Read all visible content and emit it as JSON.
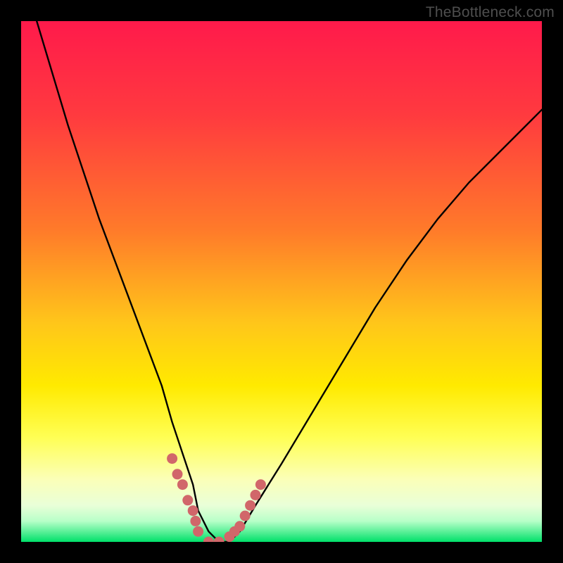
{
  "watermark": "TheBottleneck.com",
  "chart_data": {
    "type": "line",
    "title": "",
    "xlabel": "",
    "ylabel": "",
    "xlim": [
      0,
      100
    ],
    "ylim": [
      0,
      100
    ],
    "grid": false,
    "legend": false,
    "background_gradient": {
      "top_color": "#ff1a4b",
      "via": [
        {
          "stop": 0.4,
          "color": "#ff7a2a"
        },
        {
          "stop": 0.62,
          "color": "#ffea00"
        },
        {
          "stop": 0.8,
          "color": "#ffff66"
        },
        {
          "stop": 0.9,
          "color": "#fdffd0"
        }
      ],
      "bottom_color": "#00e16a"
    },
    "series": [
      {
        "name": "bottleneck-curve",
        "stroke": "#000000",
        "x": [
          3,
          6,
          9,
          12,
          15,
          18,
          21,
          24,
          27,
          29,
          31,
          33,
          34,
          36,
          38,
          40,
          42,
          45,
          50,
          56,
          62,
          68,
          74,
          80,
          86,
          92,
          98,
          100
        ],
        "values": [
          100,
          90,
          80,
          71,
          62,
          54,
          46,
          38,
          30,
          23,
          17,
          11,
          6,
          2,
          0,
          0,
          2,
          7,
          15,
          25,
          35,
          45,
          54,
          62,
          69,
          75,
          81,
          83
        ]
      },
      {
        "name": "highlight-dots",
        "stroke": "#d1666a",
        "style": "markers",
        "x": [
          29,
          30,
          31,
          32,
          33,
          33.5,
          34,
          36,
          38,
          40,
          41,
          42,
          43,
          44,
          45,
          46
        ],
        "values": [
          16,
          13,
          11,
          8,
          6,
          4,
          2,
          0,
          0,
          1,
          2,
          3,
          5,
          7,
          9,
          11
        ]
      }
    ]
  }
}
